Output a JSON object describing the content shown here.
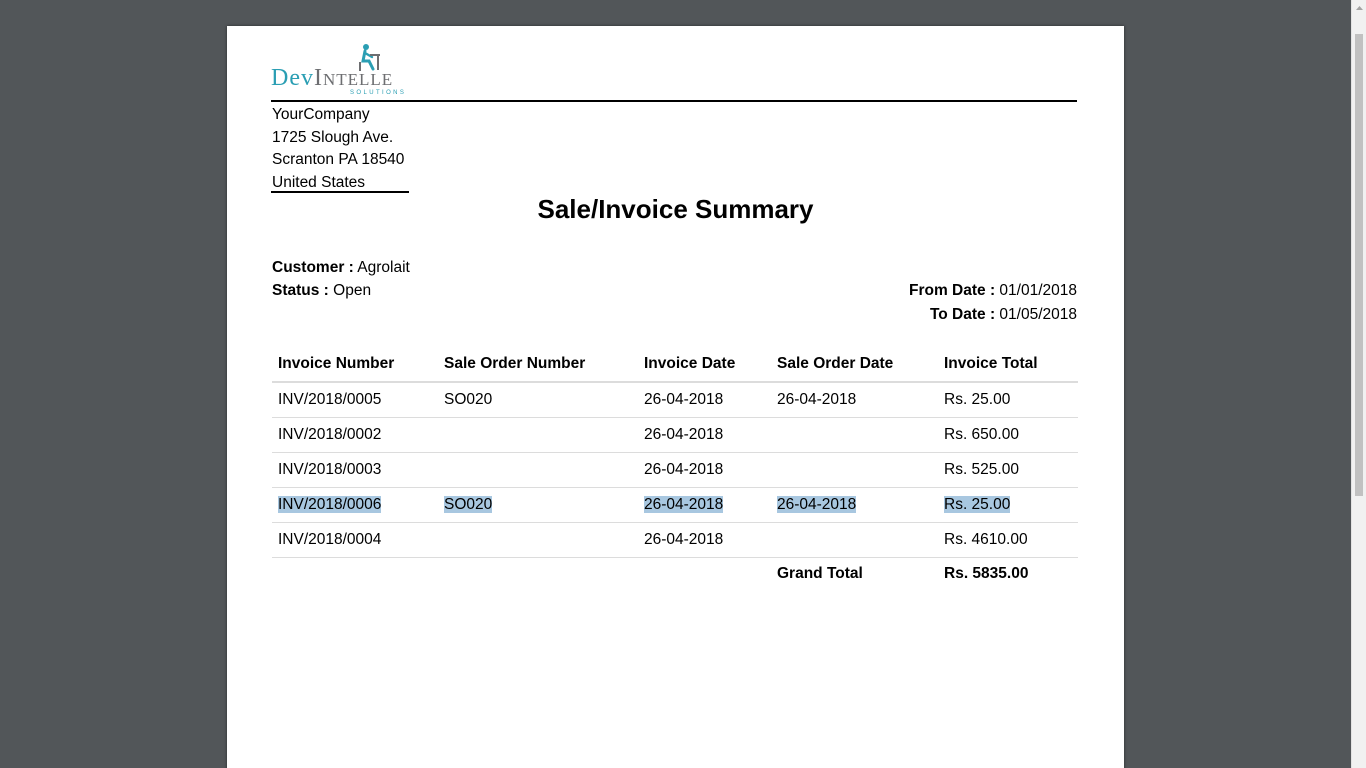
{
  "company": {
    "logo": {
      "dev": "Dev",
      "intelle": "Intelle",
      "sub": "SOLUTIONS"
    },
    "name": "YourCompany",
    "street": "1725 Slough Ave.",
    "city_line": "Scranton PA 18540",
    "country": "United States"
  },
  "report": {
    "title": "Sale/Invoice Summary",
    "customer_label": "Customer :",
    "customer_value": "Agrolait",
    "status_label": "Status :",
    "status_value": "Open",
    "from_label": "From Date :",
    "from_value": "01/01/2018",
    "to_label": "To Date :",
    "to_value": "01/05/2018"
  },
  "table": {
    "headers": [
      "Invoice Number",
      "Sale Order Number",
      "Invoice Date",
      "Sale Order Date",
      "Invoice Total"
    ],
    "rows": [
      [
        "INV/2018/0005",
        "SO020",
        "26-04-2018",
        "26-04-2018",
        "Rs. 25.00"
      ],
      [
        "INV/2018/0002",
        "",
        "26-04-2018",
        "",
        "Rs. 650.00"
      ],
      [
        "INV/2018/0003",
        "",
        "26-04-2018",
        "",
        "Rs. 525.00"
      ],
      [
        "INV/2018/0006",
        "SO020",
        "26-04-2018",
        "26-04-2018",
        "Rs. 25.00"
      ],
      [
        "INV/2018/0004",
        "",
        "26-04-2018",
        "",
        "Rs. 4610.00"
      ]
    ],
    "selected_row": 3,
    "grand_total_label": "Grand Total",
    "grand_total_value": "Rs. 5835.00"
  },
  "colors": {
    "viewer_background": "#525659",
    "brand_teal": "#2a9eb3",
    "brand_grey": "#6d6e71",
    "selection": "#a8c7e0"
  }
}
